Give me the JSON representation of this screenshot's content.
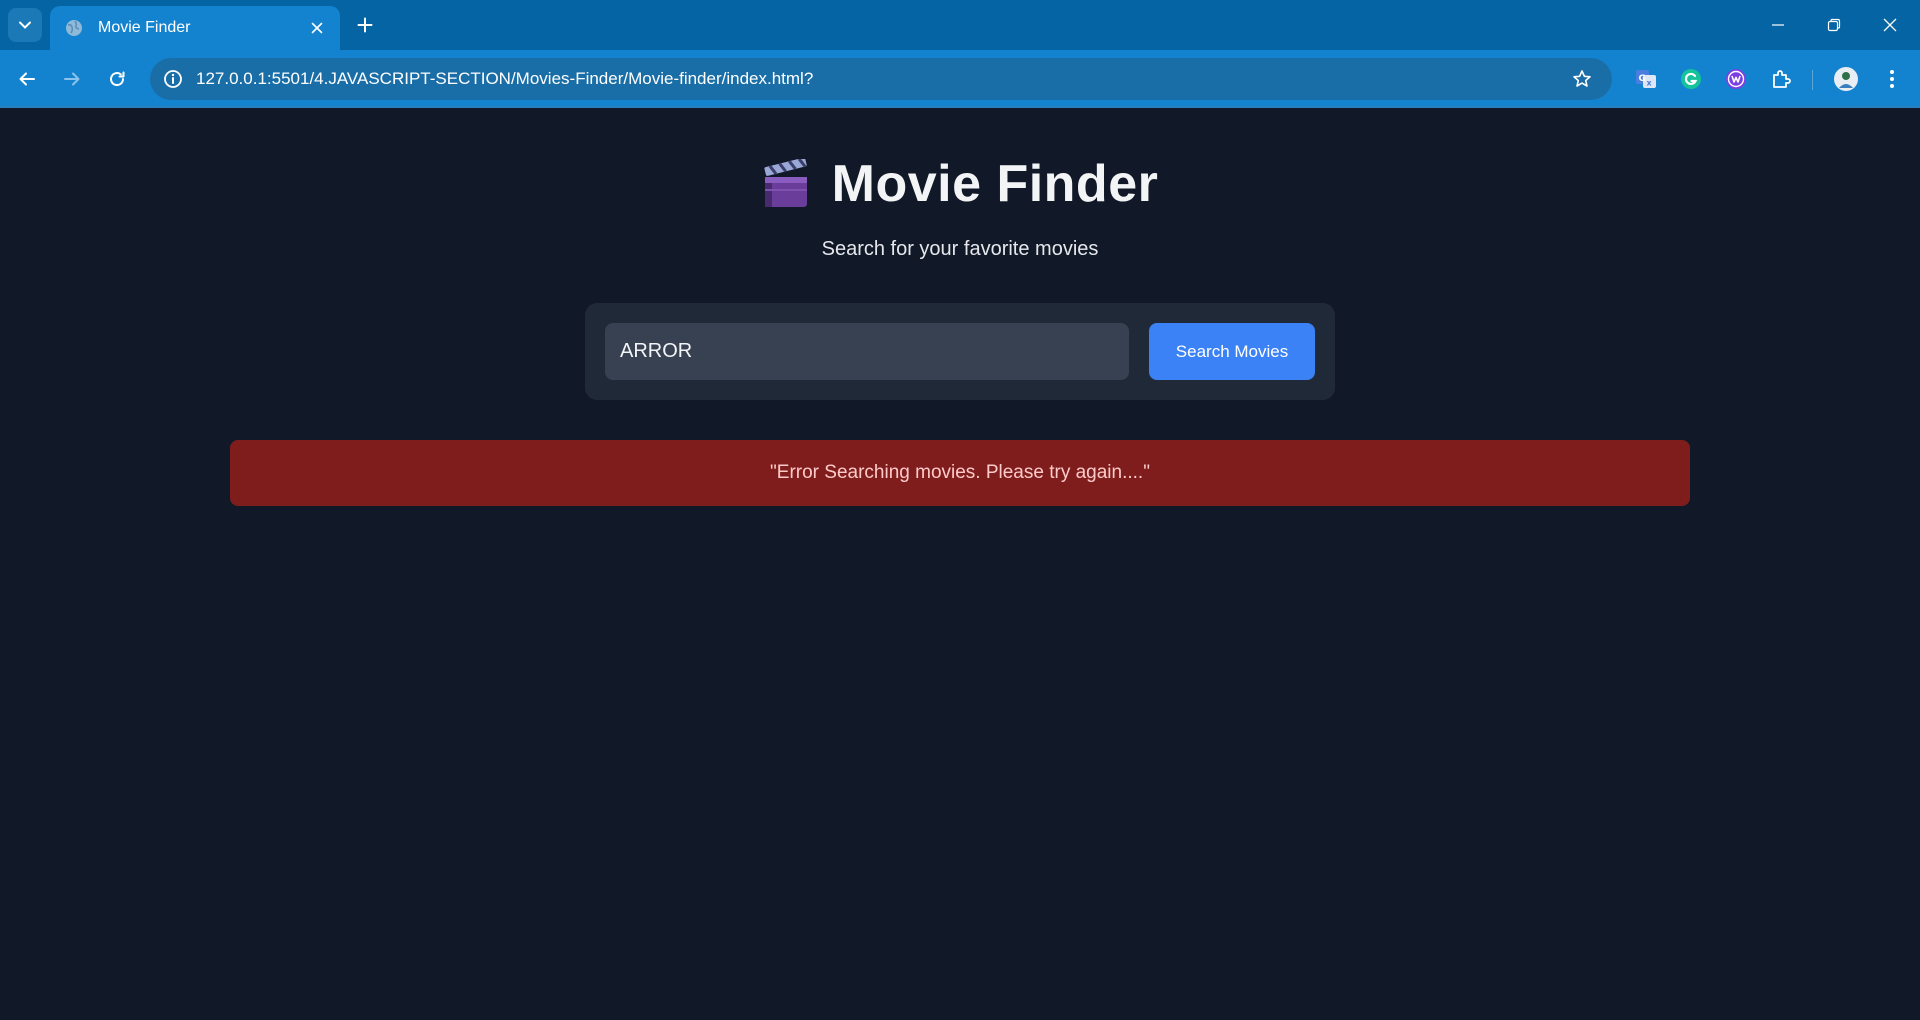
{
  "browser": {
    "tab": {
      "title": "Movie Finder",
      "favicon": "globe-icon"
    },
    "address_bar": {
      "url": "127.0.0.1:5501/4.JAVASCRIPT-SECTION/Movies-Finder/Movie-finder/index.html?"
    },
    "extensions": [
      "google-translate-icon",
      "grammarly-icon",
      "extension-w-icon",
      "puzzle-icon"
    ],
    "colors": {
      "tabbar": "#0564a3",
      "toolbar": "#1483cf"
    }
  },
  "page": {
    "header": {
      "icon": "clapperboard-icon",
      "title": "Movie Finder",
      "subtitle": "Search for your favorite movies"
    },
    "search": {
      "input_value": "ARROR",
      "button_label": "Search Movies"
    },
    "error": {
      "message": "\"Error Searching movies. Please try again....\""
    },
    "colors": {
      "background": "#111827",
      "panel": "#1f2937",
      "input": "#374151",
      "button": "#3b82f6",
      "error_bg": "#7f1d1d",
      "error_text": "#fecaca"
    }
  }
}
